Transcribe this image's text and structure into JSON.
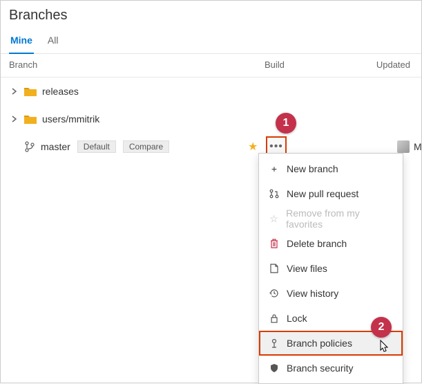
{
  "title": "Branches",
  "tabs": {
    "mine": "Mine",
    "all": "All"
  },
  "columns": {
    "branch": "Branch",
    "build": "Build",
    "updated": "Updated"
  },
  "folders": {
    "releases": "releases",
    "users": "users/mmitrik"
  },
  "master": {
    "name": "master",
    "default": "Default",
    "compare": "Compare",
    "user": "Matt"
  },
  "menu": {
    "new_branch": "New branch",
    "new_pr": "New pull request",
    "remove_fav": "Remove from my favorites",
    "delete": "Delete branch",
    "view_files": "View files",
    "view_history": "View history",
    "lock": "Lock",
    "policies": "Branch policies",
    "security": "Branch security"
  },
  "annotations": {
    "one": "1",
    "two": "2"
  }
}
